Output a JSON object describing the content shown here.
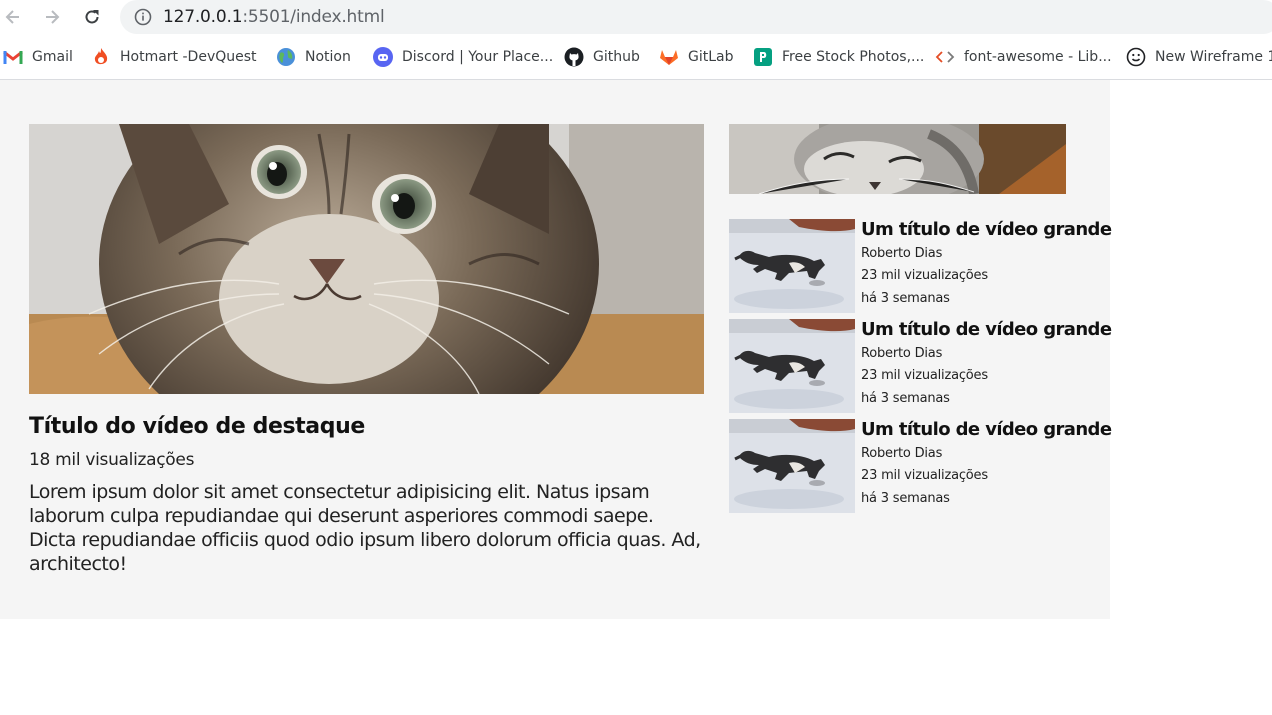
{
  "browser": {
    "url_host": "127.0.0.1",
    "url_rest": ":5501/index.html"
  },
  "bookmarks": [
    {
      "label": "Gmail",
      "icon": "gmail-icon"
    },
    {
      "label": "Hotmart -DevQuest",
      "icon": "hotmart-icon"
    },
    {
      "label": "Notion",
      "icon": "globe-icon"
    },
    {
      "label": "Discord | Your Place...",
      "icon": "discord-icon"
    },
    {
      "label": "Github",
      "icon": "github-icon"
    },
    {
      "label": "GitLab",
      "icon": "gitlab-icon"
    },
    {
      "label": "Free Stock Photos,...",
      "icon": "pexels-icon"
    },
    {
      "label": "font-awesome - Lib...",
      "icon": "code-icon"
    },
    {
      "label": "New Wireframe 1",
      "icon": "smiley-icon"
    }
  ],
  "featured": {
    "title": "Título do vídeo de destaque",
    "views": "18 mil visualizações",
    "description": "Lorem ipsum dolor sit amet consectetur adipisicing elit. Natus ipsam laborum culpa repudiandae qui deserunt asperiores commodi saepe. Dicta repudiandae officiis quod odio ipsum libero dolorum officia quas. Ad, architecto!"
  },
  "videos": [
    {
      "title": "Um título de vídeo grande",
      "channel": "Roberto Dias",
      "views": "23 mil vizualizações",
      "age": "há 3 semanas"
    },
    {
      "title": "Um título de vídeo grande",
      "channel": "Roberto Dias",
      "views": "23 mil vizualizações",
      "age": "há 3 semanas"
    },
    {
      "title": "Um título de vídeo grande",
      "channel": "Roberto Dias",
      "views": "23 mil vizualizações",
      "age": "há 3 semanas"
    }
  ]
}
